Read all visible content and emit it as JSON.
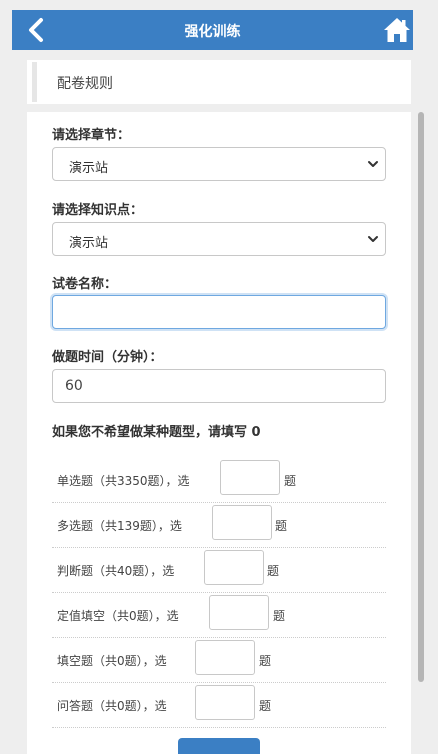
{
  "header": {
    "title": "强化训练",
    "back_icon": "chevron-left-icon",
    "home_icon": "home-icon",
    "color": "#3b7fc4"
  },
  "rules_tab": {
    "label": "配卷规则"
  },
  "form": {
    "chapter": {
      "label": "请选择章节：",
      "selected": "演示站"
    },
    "knowledge": {
      "label": "请选择知识点：",
      "selected": "演示站"
    },
    "paper_name": {
      "label": "试卷名称：",
      "value": ""
    },
    "duration": {
      "label": "做题时间（分钟）：",
      "value": "60"
    },
    "note": "如果您不希望做某种题型，请填写 0"
  },
  "question_types": [
    {
      "text": "单选题（共3350题），选",
      "value": "",
      "unit": "题"
    },
    {
      "text": "多选题（共139题），选",
      "value": "",
      "unit": "题"
    },
    {
      "text": "判断题（共40题），选",
      "value": "",
      "unit": "题"
    },
    {
      "text": "定值填空（共0题），选",
      "value": "",
      "unit": "题"
    },
    {
      "text": "填空题（共0题），选",
      "value": "",
      "unit": "题"
    },
    {
      "text": "问答题（共0题），选",
      "value": "",
      "unit": "题"
    }
  ]
}
